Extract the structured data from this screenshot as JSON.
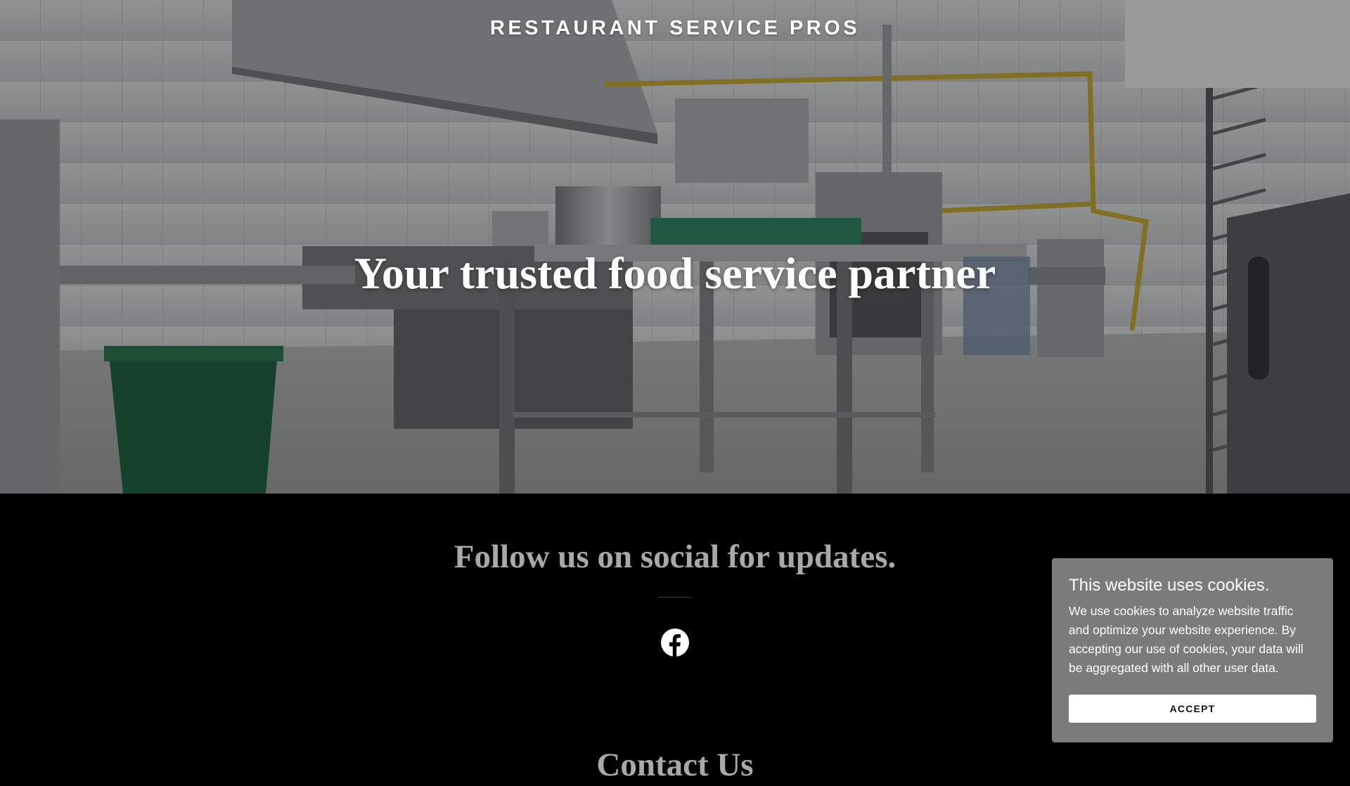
{
  "header": {
    "brand": "RESTAURANT SERVICE PROS"
  },
  "hero": {
    "title": "Your trusted food service partner"
  },
  "social": {
    "heading": "Follow us on social for updates.",
    "facebook_icon": "facebook-icon"
  },
  "contact": {
    "heading": "Contact Us"
  },
  "cookie_banner": {
    "title": "This website uses cookies.",
    "body": "We use cookies to analyze website traffic and optimize your website experience. By accepting our use of cookies, your data will be aggregated with all other user data.",
    "accept_label": "ACCEPT"
  },
  "colors": {
    "background": "#000000",
    "cookie_panel": "#7b7b7b",
    "heading_gray": "#a9a9a9",
    "accent_white": "#ffffff"
  }
}
